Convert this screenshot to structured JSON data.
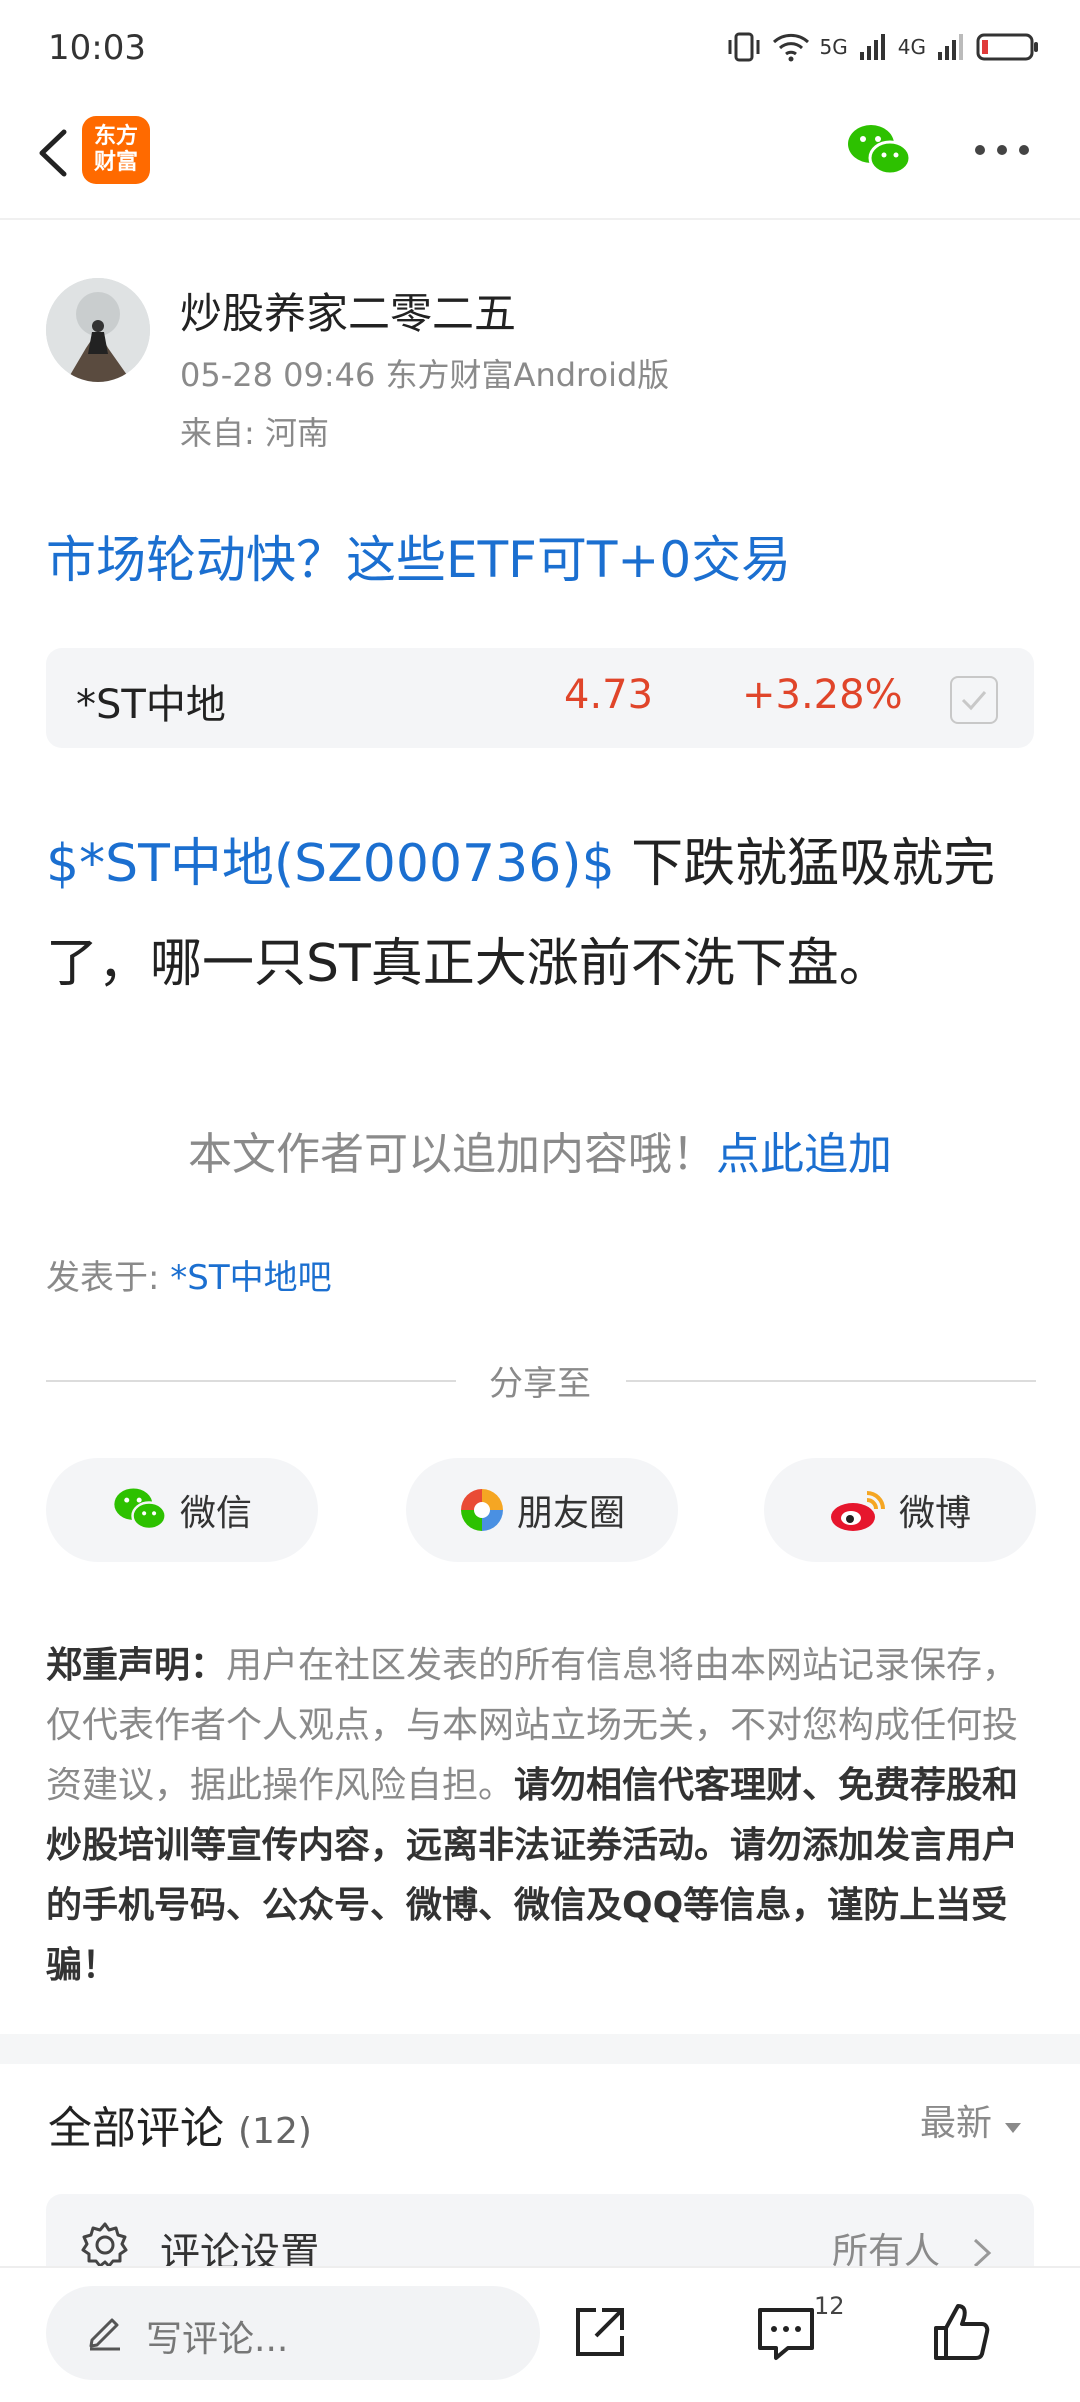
{
  "status_bar": {
    "time": "10:03",
    "net1": "5G",
    "net2": "4G"
  },
  "nav": {
    "logo_line1": "东方",
    "logo_line2": "财富",
    "icons": [
      "back-icon",
      "wechat-icon",
      "more-icon"
    ]
  },
  "author": {
    "name": "炒股养家二零二五",
    "meta": "05-28 09:46 东方财富Android版",
    "location": "来自: 河南"
  },
  "article": {
    "title": "市场轮动快？这些ETF可T+0交易"
  },
  "stock": {
    "name": "*ST中地",
    "price": "4.73",
    "change": "+3.28%",
    "color": "#e0452a"
  },
  "post": {
    "link": "$*ST中地(SZ000736)$",
    "text": " 下跌就猛吸就完了，哪一只ST真正大涨前不洗下盘。"
  },
  "append": {
    "prompt": "本文作者可以追加内容哦！",
    "link": "点此追加"
  },
  "published": {
    "label": "发表于: ",
    "forum": "*ST中地吧"
  },
  "share": {
    "label": "分享至",
    "wechat": "微信",
    "moments": "朋友圈",
    "weibo": "微博"
  },
  "disclaimer": {
    "heading": "郑重声明：",
    "text": "用户在社区发表的所有信息将由本网站记录保存，仅代表作者个人观点，与本网站立场无关，不对您构成任何投资建议，据此操作风险自担。",
    "warning": "请勿相信代客理财、免费荐股和炒股培训等宣传内容，远离非法证券活动。请勿添加发言用户的手机号码、公众号、微博、微信及QQ等信息，谨防上当受骗！"
  },
  "comments": {
    "title": "全部评论",
    "count": "(12)",
    "sort": "最新",
    "settings_label": "评论设置",
    "settings_value": "所有人"
  },
  "bottom": {
    "placeholder": "写评论...",
    "comment_count": "12"
  },
  "colors": {
    "link_blue": "#1b6fd0",
    "up_red": "#e0452a",
    "brand_orange": "#ff6a00"
  }
}
